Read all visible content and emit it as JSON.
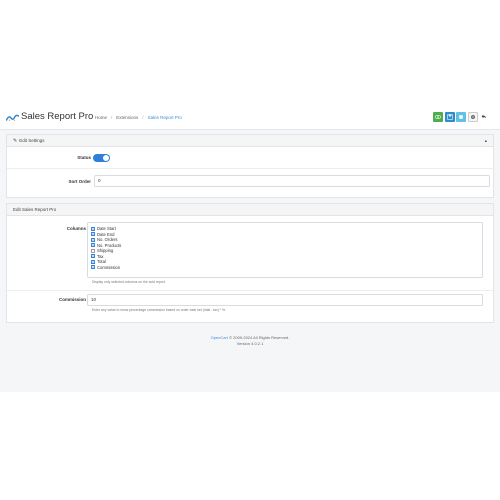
{
  "header": {
    "title": "Sales Report Pro",
    "breadcrumb": [
      "Home",
      "Extensions",
      "Sales Report Pro"
    ],
    "actions": [
      {
        "icon": "eye-icon",
        "color": "#4cae4c"
      },
      {
        "icon": "save-icon",
        "color": "#2f8ccc"
      },
      {
        "icon": "square-icon",
        "color": "#5fc1e8"
      },
      {
        "icon": "gear-icon",
        "color": "#f5f5f5"
      },
      {
        "icon": "back-arrow-icon",
        "color": "transparent"
      }
    ]
  },
  "edit_settings": {
    "heading": "Edit Settings",
    "status_label": "Status",
    "status_on": true,
    "sort_order_label": "Sort Order",
    "sort_order_value": "0"
  },
  "sales_report": {
    "heading": "Edit Sales Report Pro",
    "columns_label": "Columns",
    "columns": [
      {
        "label": "Date Start",
        "checked": true
      },
      {
        "label": "Date End",
        "checked": true
      },
      {
        "label": "No. Orders",
        "checked": true
      },
      {
        "label": "No. Products",
        "checked": true
      },
      {
        "label": "Shipping",
        "checked": false
      },
      {
        "label": "Tax",
        "checked": true
      },
      {
        "label": "Total",
        "checked": true
      },
      {
        "label": "Commission",
        "checked": true
      }
    ],
    "columns_help": "Display only selected columns on the sold report.",
    "commission_label": "Commission",
    "commission_value": "10",
    "commission_help": "Enter any value to show percentage commission based on order total net (total - tax) * %."
  },
  "footer": {
    "brand": "OpenCart",
    "copyright": "© 2009-2024 All Rights Reserved.",
    "version": "Version 4.0.2.1"
  },
  "colors": {
    "accent": "#2f7fd8",
    "link": "#3a8fd8",
    "success": "#4cae4c"
  }
}
